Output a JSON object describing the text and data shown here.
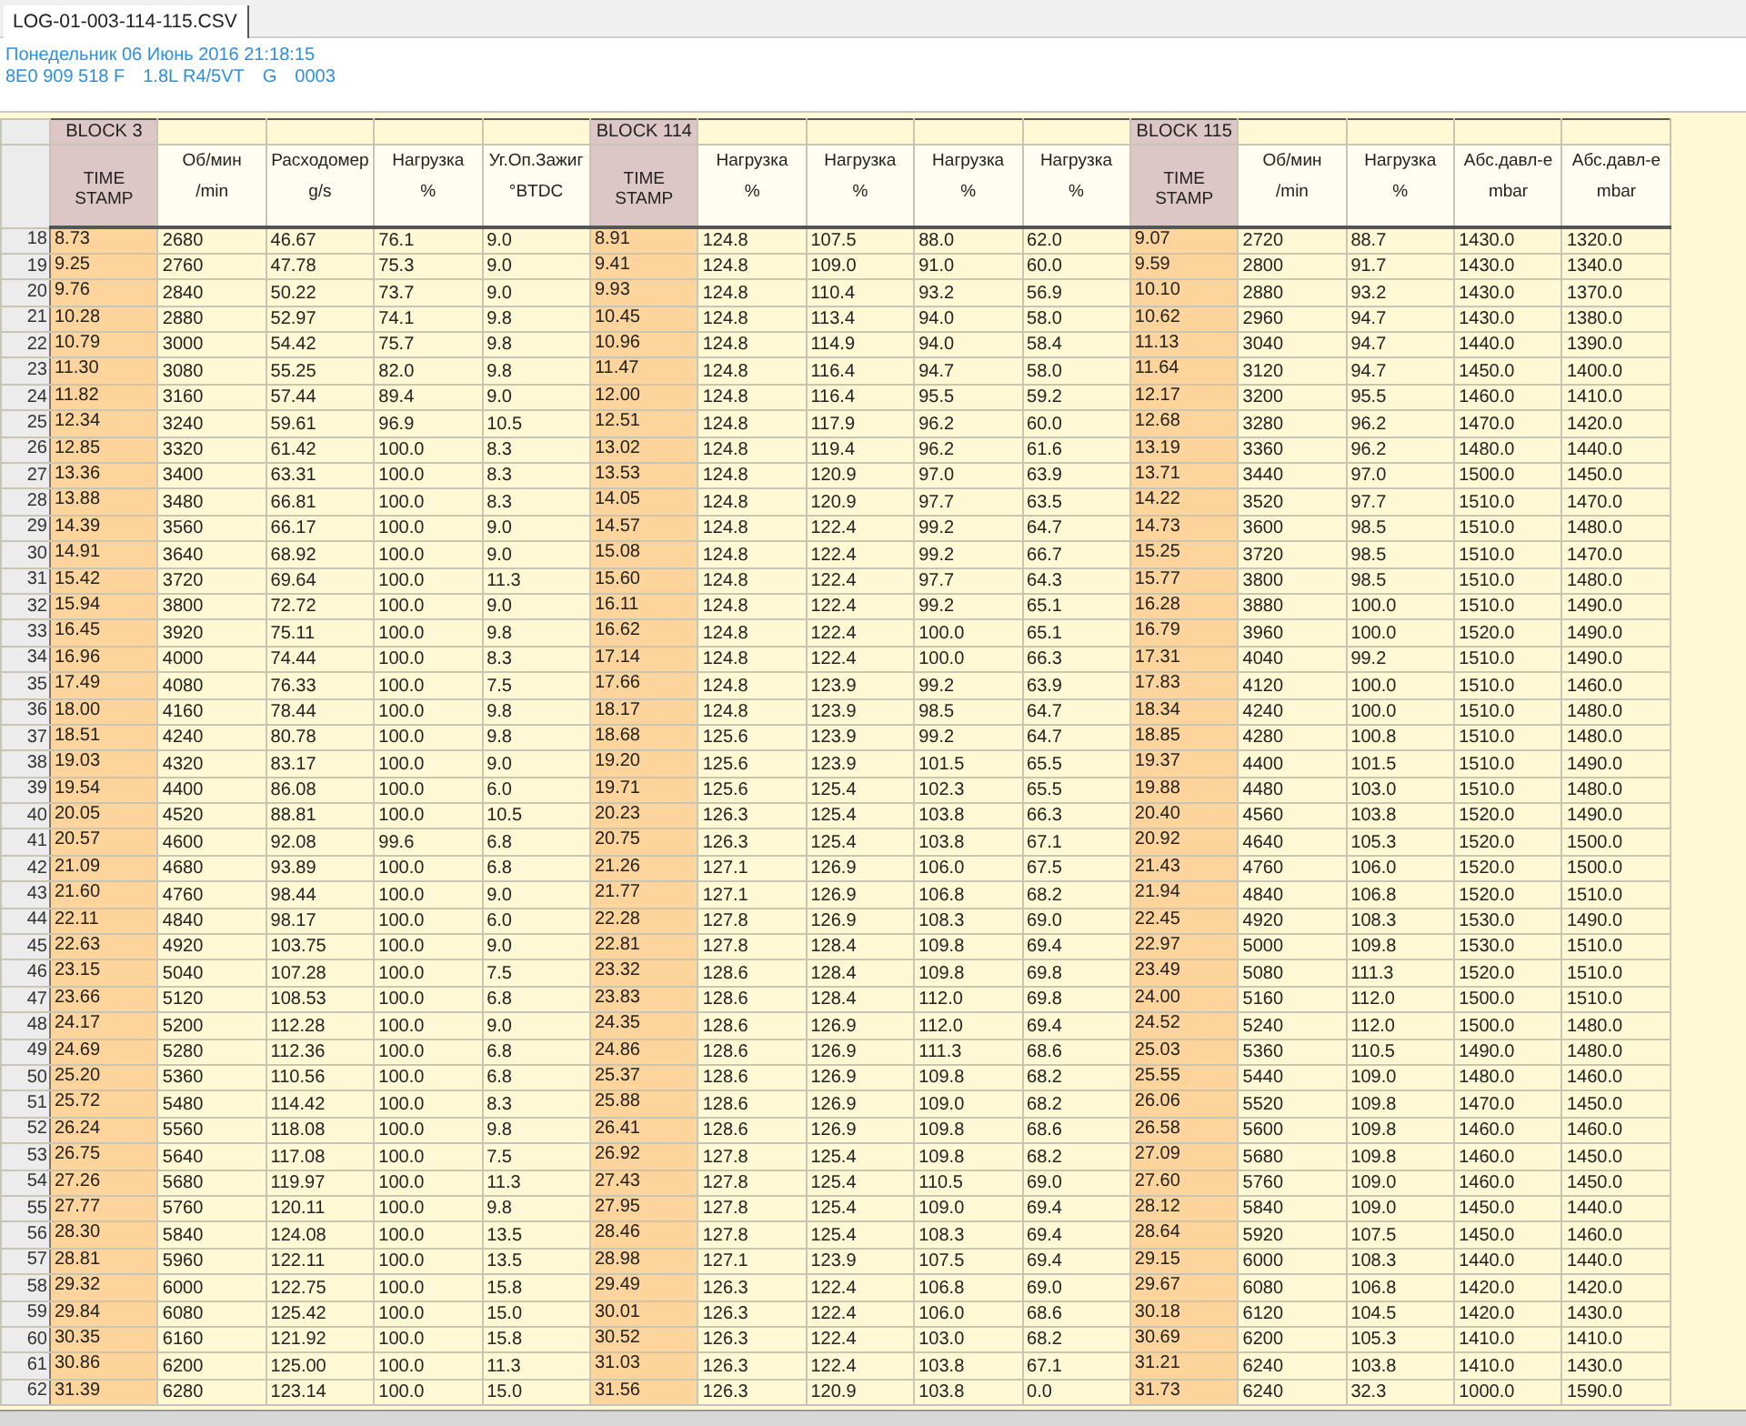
{
  "tabs": [
    {
      "label": "LOG-01-003-114-115.CSV",
      "selected": true
    }
  ],
  "info": {
    "date": "Понедельник 06 Июнь 2016 21:18:15",
    "ecu_parts": [
      "8E0 909 518 F",
      "1.8L R4/5VT",
      "G",
      "0003"
    ]
  },
  "table": {
    "columns": [
      {
        "kind": "timestamp",
        "block": "BLOCK 3",
        "label": "TIME STAMP"
      },
      {
        "kind": "value",
        "label": "Об/мин",
        "unit": "/min"
      },
      {
        "kind": "value",
        "label": "Расходомер",
        "unit": "g/s"
      },
      {
        "kind": "value",
        "label": "Нагрузка",
        "unit": "%"
      },
      {
        "kind": "value",
        "label": "Уг.Оп.Зажиг",
        "unit": "°BTDC"
      },
      {
        "kind": "timestamp",
        "block": "BLOCK 114",
        "label": "TIME STAMP"
      },
      {
        "kind": "value",
        "label": "Нагрузка",
        "unit": "%"
      },
      {
        "kind": "value",
        "label": "Нагрузка",
        "unit": "%"
      },
      {
        "kind": "value",
        "label": "Нагрузка",
        "unit": "%"
      },
      {
        "kind": "value",
        "label": "Нагрузка",
        "unit": "%"
      },
      {
        "kind": "timestamp",
        "block": "BLOCK 115",
        "label": "TIME STAMP"
      },
      {
        "kind": "value",
        "label": "Об/мин",
        "unit": "/min"
      },
      {
        "kind": "value",
        "label": "Нагрузка",
        "unit": "%"
      },
      {
        "kind": "value",
        "label": "Абс.давл-е",
        "unit": "mbar"
      },
      {
        "kind": "value",
        "label": "Абс.давл-е",
        "unit": "mbar"
      }
    ],
    "rows": [
      {
        "num": "18",
        "cells": [
          "8.73",
          "2680",
          "46.67",
          "76.1",
          "9.0",
          "8.91",
          "124.8",
          "107.5",
          "88.0",
          "62.0",
          "9.07",
          "2720",
          "88.7",
          "1430.0",
          "1320.0"
        ]
      },
      {
        "num": "19",
        "cells": [
          "9.25",
          "2760",
          "47.78",
          "75.3",
          "9.0",
          "9.41",
          "124.8",
          "109.0",
          "91.0",
          "60.0",
          "9.59",
          "2800",
          "91.7",
          "1430.0",
          "1340.0"
        ]
      },
      {
        "num": "20",
        "cells": [
          "9.76",
          "2840",
          "50.22",
          "73.7",
          "9.0",
          "9.93",
          "124.8",
          "110.4",
          "93.2",
          "56.9",
          "10.10",
          "2880",
          "93.2",
          "1430.0",
          "1370.0"
        ]
      },
      {
        "num": "21",
        "cells": [
          "10.28",
          "2880",
          "52.97",
          "74.1",
          "9.8",
          "10.45",
          "124.8",
          "113.4",
          "94.0",
          "58.0",
          "10.62",
          "2960",
          "94.7",
          "1430.0",
          "1380.0"
        ]
      },
      {
        "num": "22",
        "cells": [
          "10.79",
          "3000",
          "54.42",
          "75.7",
          "9.8",
          "10.96",
          "124.8",
          "114.9",
          "94.0",
          "58.4",
          "11.13",
          "3040",
          "94.7",
          "1440.0",
          "1390.0"
        ]
      },
      {
        "num": "23",
        "cells": [
          "11.30",
          "3080",
          "55.25",
          "82.0",
          "9.8",
          "11.47",
          "124.8",
          "116.4",
          "94.7",
          "58.0",
          "11.64",
          "3120",
          "94.7",
          "1450.0",
          "1400.0"
        ]
      },
      {
        "num": "24",
        "cells": [
          "11.82",
          "3160",
          "57.44",
          "89.4",
          "9.0",
          "12.00",
          "124.8",
          "116.4",
          "95.5",
          "59.2",
          "12.17",
          "3200",
          "95.5",
          "1460.0",
          "1410.0"
        ]
      },
      {
        "num": "25",
        "cells": [
          "12.34",
          "3240",
          "59.61",
          "96.9",
          "10.5",
          "12.51",
          "124.8",
          "117.9",
          "96.2",
          "60.0",
          "12.68",
          "3280",
          "96.2",
          "1470.0",
          "1420.0"
        ]
      },
      {
        "num": "26",
        "cells": [
          "12.85",
          "3320",
          "61.42",
          "100.0",
          "8.3",
          "13.02",
          "124.8",
          "119.4",
          "96.2",
          "61.6",
          "13.19",
          "3360",
          "96.2",
          "1480.0",
          "1440.0"
        ]
      },
      {
        "num": "27",
        "cells": [
          "13.36",
          "3400",
          "63.31",
          "100.0",
          "8.3",
          "13.53",
          "124.8",
          "120.9",
          "97.0",
          "63.9",
          "13.71",
          "3440",
          "97.0",
          "1500.0",
          "1450.0"
        ]
      },
      {
        "num": "28",
        "cells": [
          "13.88",
          "3480",
          "66.81",
          "100.0",
          "8.3",
          "14.05",
          "124.8",
          "120.9",
          "97.7",
          "63.5",
          "14.22",
          "3520",
          "97.7",
          "1510.0",
          "1470.0"
        ]
      },
      {
        "num": "29",
        "cells": [
          "14.39",
          "3560",
          "66.17",
          "100.0",
          "9.0",
          "14.57",
          "124.8",
          "122.4",
          "99.2",
          "64.7",
          "14.73",
          "3600",
          "98.5",
          "1510.0",
          "1480.0"
        ]
      },
      {
        "num": "30",
        "cells": [
          "14.91",
          "3640",
          "68.92",
          "100.0",
          "9.0",
          "15.08",
          "124.8",
          "122.4",
          "99.2",
          "66.7",
          "15.25",
          "3720",
          "98.5",
          "1510.0",
          "1470.0"
        ]
      },
      {
        "num": "31",
        "cells": [
          "15.42",
          "3720",
          "69.64",
          "100.0",
          "11.3",
          "15.60",
          "124.8",
          "122.4",
          "97.7",
          "64.3",
          "15.77",
          "3800",
          "98.5",
          "1510.0",
          "1480.0"
        ]
      },
      {
        "num": "32",
        "cells": [
          "15.94",
          "3800",
          "72.72",
          "100.0",
          "9.0",
          "16.11",
          "124.8",
          "122.4",
          "99.2",
          "65.1",
          "16.28",
          "3880",
          "100.0",
          "1510.0",
          "1490.0"
        ]
      },
      {
        "num": "33",
        "cells": [
          "16.45",
          "3920",
          "75.11",
          "100.0",
          "9.8",
          "16.62",
          "124.8",
          "122.4",
          "100.0",
          "65.1",
          "16.79",
          "3960",
          "100.0",
          "1520.0",
          "1490.0"
        ]
      },
      {
        "num": "34",
        "cells": [
          "16.96",
          "4000",
          "74.44",
          "100.0",
          "8.3",
          "17.14",
          "124.8",
          "122.4",
          "100.0",
          "66.3",
          "17.31",
          "4040",
          "99.2",
          "1510.0",
          "1490.0"
        ]
      },
      {
        "num": "35",
        "cells": [
          "17.49",
          "4080",
          "76.33",
          "100.0",
          "7.5",
          "17.66",
          "124.8",
          "123.9",
          "99.2",
          "63.9",
          "17.83",
          "4120",
          "100.0",
          "1510.0",
          "1460.0"
        ]
      },
      {
        "num": "36",
        "cells": [
          "18.00",
          "4160",
          "78.44",
          "100.0",
          "9.8",
          "18.17",
          "124.8",
          "123.9",
          "98.5",
          "64.7",
          "18.34",
          "4240",
          "100.0",
          "1510.0",
          "1480.0"
        ]
      },
      {
        "num": "37",
        "cells": [
          "18.51",
          "4240",
          "80.78",
          "100.0",
          "9.8",
          "18.68",
          "125.6",
          "123.9",
          "99.2",
          "64.7",
          "18.85",
          "4280",
          "100.8",
          "1510.0",
          "1480.0"
        ]
      },
      {
        "num": "38",
        "cells": [
          "19.03",
          "4320",
          "83.17",
          "100.0",
          "9.0",
          "19.20",
          "125.6",
          "123.9",
          "101.5",
          "65.5",
          "19.37",
          "4400",
          "101.5",
          "1510.0",
          "1490.0"
        ]
      },
      {
        "num": "39",
        "cells": [
          "19.54",
          "4400",
          "86.08",
          "100.0",
          "6.0",
          "19.71",
          "125.6",
          "125.4",
          "102.3",
          "65.5",
          "19.88",
          "4480",
          "103.0",
          "1510.0",
          "1480.0"
        ]
      },
      {
        "num": "40",
        "cells": [
          "20.05",
          "4520",
          "88.81",
          "100.0",
          "10.5",
          "20.23",
          "126.3",
          "125.4",
          "103.8",
          "66.3",
          "20.40",
          "4560",
          "103.8",
          "1520.0",
          "1490.0"
        ]
      },
      {
        "num": "41",
        "cells": [
          "20.57",
          "4600",
          "92.08",
          "99.6",
          "6.8",
          "20.75",
          "126.3",
          "125.4",
          "103.8",
          "67.1",
          "20.92",
          "4640",
          "105.3",
          "1520.0",
          "1500.0"
        ]
      },
      {
        "num": "42",
        "cells": [
          "21.09",
          "4680",
          "93.89",
          "100.0",
          "6.8",
          "21.26",
          "127.1",
          "126.9",
          "106.0",
          "67.5",
          "21.43",
          "4760",
          "106.0",
          "1520.0",
          "1500.0"
        ]
      },
      {
        "num": "43",
        "cells": [
          "21.60",
          "4760",
          "98.44",
          "100.0",
          "9.0",
          "21.77",
          "127.1",
          "126.9",
          "106.8",
          "68.2",
          "21.94",
          "4840",
          "106.8",
          "1520.0",
          "1510.0"
        ]
      },
      {
        "num": "44",
        "cells": [
          "22.11",
          "4840",
          "98.17",
          "100.0",
          "6.0",
          "22.28",
          "127.8",
          "126.9",
          "108.3",
          "69.0",
          "22.45",
          "4920",
          "108.3",
          "1530.0",
          "1490.0"
        ]
      },
      {
        "num": "45",
        "cells": [
          "22.63",
          "4920",
          "103.75",
          "100.0",
          "9.0",
          "22.81",
          "127.8",
          "128.4",
          "109.8",
          "69.4",
          "22.97",
          "5000",
          "109.8",
          "1530.0",
          "1510.0"
        ]
      },
      {
        "num": "46",
        "cells": [
          "23.15",
          "5040",
          "107.28",
          "100.0",
          "7.5",
          "23.32",
          "128.6",
          "128.4",
          "109.8",
          "69.8",
          "23.49",
          "5080",
          "111.3",
          "1520.0",
          "1510.0"
        ]
      },
      {
        "num": "47",
        "cells": [
          "23.66",
          "5120",
          "108.53",
          "100.0",
          "6.8",
          "23.83",
          "128.6",
          "128.4",
          "112.0",
          "69.8",
          "24.00",
          "5160",
          "112.0",
          "1500.0",
          "1510.0"
        ]
      },
      {
        "num": "48",
        "cells": [
          "24.17",
          "5200",
          "112.28",
          "100.0",
          "9.0",
          "24.35",
          "128.6",
          "126.9",
          "112.0",
          "69.4",
          "24.52",
          "5240",
          "112.0",
          "1500.0",
          "1480.0"
        ]
      },
      {
        "num": "49",
        "cells": [
          "24.69",
          "5280",
          "112.36",
          "100.0",
          "6.8",
          "24.86",
          "128.6",
          "126.9",
          "111.3",
          "68.6",
          "25.03",
          "5360",
          "110.5",
          "1490.0",
          "1480.0"
        ]
      },
      {
        "num": "50",
        "cells": [
          "25.20",
          "5360",
          "110.56",
          "100.0",
          "6.8",
          "25.37",
          "128.6",
          "126.9",
          "109.8",
          "68.2",
          "25.55",
          "5440",
          "109.0",
          "1480.0",
          "1460.0"
        ]
      },
      {
        "num": "51",
        "cells": [
          "25.72",
          "5480",
          "114.42",
          "100.0",
          "8.3",
          "25.88",
          "128.6",
          "126.9",
          "109.0",
          "68.2",
          "26.06",
          "5520",
          "109.8",
          "1470.0",
          "1450.0"
        ]
      },
      {
        "num": "52",
        "cells": [
          "26.24",
          "5560",
          "118.08",
          "100.0",
          "9.8",
          "26.41",
          "128.6",
          "126.9",
          "109.8",
          "68.6",
          "26.58",
          "5600",
          "109.8",
          "1460.0",
          "1460.0"
        ]
      },
      {
        "num": "53",
        "cells": [
          "26.75",
          "5640",
          "117.08",
          "100.0",
          "7.5",
          "26.92",
          "127.8",
          "125.4",
          "109.8",
          "68.2",
          "27.09",
          "5680",
          "109.8",
          "1460.0",
          "1450.0"
        ]
      },
      {
        "num": "54",
        "cells": [
          "27.26",
          "5680",
          "119.97",
          "100.0",
          "11.3",
          "27.43",
          "127.8",
          "125.4",
          "110.5",
          "69.0",
          "27.60",
          "5760",
          "109.0",
          "1460.0",
          "1450.0"
        ]
      },
      {
        "num": "55",
        "cells": [
          "27.77",
          "5760",
          "120.11",
          "100.0",
          "9.8",
          "27.95",
          "127.8",
          "125.4",
          "109.0",
          "69.4",
          "28.12",
          "5840",
          "109.0",
          "1450.0",
          "1440.0"
        ]
      },
      {
        "num": "56",
        "cells": [
          "28.30",
          "5840",
          "124.08",
          "100.0",
          "13.5",
          "28.46",
          "127.8",
          "125.4",
          "108.3",
          "69.4",
          "28.64",
          "5920",
          "107.5",
          "1450.0",
          "1460.0"
        ]
      },
      {
        "num": "57",
        "cells": [
          "28.81",
          "5960",
          "122.11",
          "100.0",
          "13.5",
          "28.98",
          "127.1",
          "123.9",
          "107.5",
          "69.4",
          "29.15",
          "6000",
          "108.3",
          "1440.0",
          "1440.0"
        ]
      },
      {
        "num": "58",
        "cells": [
          "29.32",
          "6000",
          "122.75",
          "100.0",
          "15.8",
          "29.49",
          "126.3",
          "122.4",
          "106.8",
          "69.0",
          "29.67",
          "6080",
          "106.8",
          "1420.0",
          "1420.0"
        ]
      },
      {
        "num": "59",
        "cells": [
          "29.84",
          "6080",
          "125.42",
          "100.0",
          "15.0",
          "30.01",
          "126.3",
          "122.4",
          "106.0",
          "68.6",
          "30.18",
          "6120",
          "104.5",
          "1420.0",
          "1430.0"
        ]
      },
      {
        "num": "60",
        "cells": [
          "30.35",
          "6160",
          "121.92",
          "100.0",
          "15.8",
          "30.52",
          "126.3",
          "122.4",
          "103.0",
          "68.2",
          "30.69",
          "6200",
          "105.3",
          "1410.0",
          "1410.0"
        ]
      },
      {
        "num": "61",
        "cells": [
          "30.86",
          "6200",
          "125.00",
          "100.0",
          "11.3",
          "31.03",
          "126.3",
          "122.4",
          "103.8",
          "67.1",
          "31.21",
          "6240",
          "103.8",
          "1410.0",
          "1430.0"
        ]
      },
      {
        "num": "62",
        "cells": [
          "31.39",
          "6280",
          "123.14",
          "100.0",
          "15.0",
          "31.56",
          "126.3",
          "120.9",
          "103.8",
          "0.0",
          "31.73",
          "6240",
          "32.3",
          "1000.0",
          "1590.0"
        ]
      }
    ]
  }
}
